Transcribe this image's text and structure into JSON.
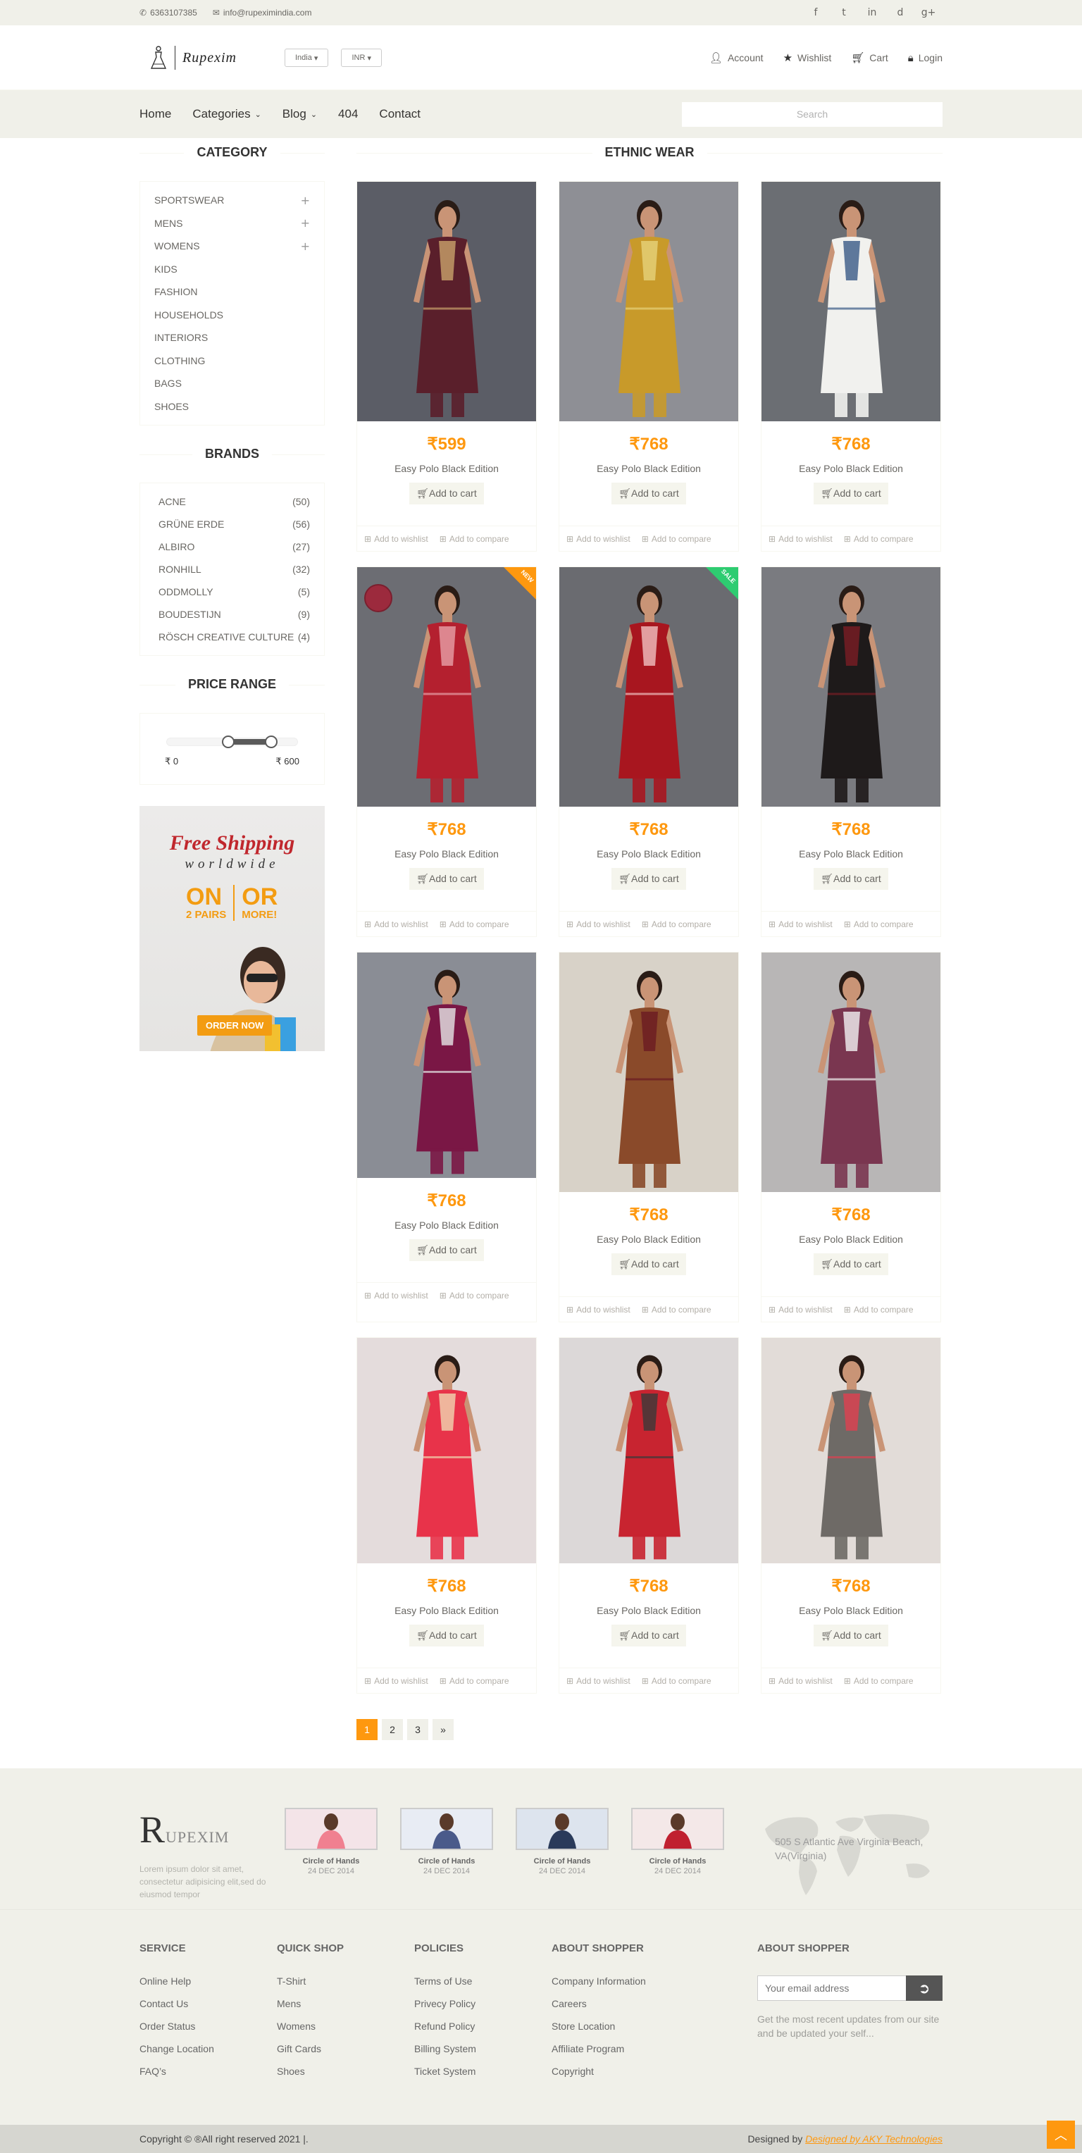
{
  "topbar": {
    "phone": "6363107385",
    "email": "info@rupeximindia.com",
    "social": [
      "f",
      "t",
      "in",
      "d",
      "g+"
    ]
  },
  "header": {
    "logo_text": "Rupexim",
    "country": "India",
    "currency": "INR",
    "nav": {
      "account": "Account",
      "wishlist": "Wishlist",
      "cart": "Cart",
      "login": "Login"
    }
  },
  "menu": {
    "items": [
      "Home",
      "Categories",
      "Blog",
      "404",
      "Contact"
    ],
    "search_placeholder": "Search"
  },
  "sidebar": {
    "category_title": "Category",
    "categories": [
      {
        "label": "SPORTSWEAR",
        "expand": "+"
      },
      {
        "label": "MENS",
        "expand": "+"
      },
      {
        "label": "WOMENS",
        "expand": "+"
      },
      {
        "label": "KIDS",
        "expand": ""
      },
      {
        "label": "FASHION",
        "expand": ""
      },
      {
        "label": "HOUSEHOLDS",
        "expand": ""
      },
      {
        "label": "INTERIORS",
        "expand": ""
      },
      {
        "label": "CLOTHING",
        "expand": ""
      },
      {
        "label": "BAGS",
        "expand": ""
      },
      {
        "label": "SHOES",
        "expand": ""
      }
    ],
    "brands_title": "Brands",
    "brands": [
      {
        "name": "ACNE",
        "count": "(50)"
      },
      {
        "name": "GRÜNE ERDE",
        "count": "(56)"
      },
      {
        "name": "ALBIRO",
        "count": "(27)"
      },
      {
        "name": "RONHILL",
        "count": "(32)"
      },
      {
        "name": "ODDMOLLY",
        "count": "(5)"
      },
      {
        "name": "BOUDESTIJN",
        "count": "(9)"
      },
      {
        "name": "RÖSCH CREATIVE CULTURE",
        "count": "(4)"
      }
    ],
    "price_title": "Price Range",
    "price_min": "₹ 0",
    "price_max": "₹ 600",
    "ad": {
      "line1": "Free Shipping",
      "line2": "worldwide",
      "on": "ON",
      "pairs": "2 PAIRS",
      "or": "OR",
      "more": "MORE!",
      "button": "ORDER NOW"
    }
  },
  "products": {
    "title": "Ethnic Wear",
    "wishlist_label": "Add to wishlist",
    "compare_label": "Add to compare",
    "cart_label": "Add to cart",
    "items": [
      {
        "price": "₹599",
        "name": "Easy Polo Black Edition",
        "color": "#5a1f2b",
        "bg": "#5b5d66",
        "trim": "#c9a26b"
      },
      {
        "price": "₹768",
        "name": "Easy Polo Black Edition",
        "color": "#c89a2a",
        "bg": "#8e8f95",
        "trim": "#e6d27a"
      },
      {
        "price": "₹768",
        "name": "Easy Polo Black Edition",
        "color": "#f1f1ee",
        "bg": "#6b6e73",
        "trim": "#3a5a86"
      },
      {
        "price": "₹768",
        "name": "Easy Polo Black Edition",
        "color": "#b4202f",
        "bg": "#6c6d73",
        "trim": "#e7a0a8",
        "badge": "NEW"
      },
      {
        "price": "₹768",
        "name": "Easy Polo Black Edition",
        "color": "#a8161f",
        "bg": "#6a6b70",
        "trim": "#f0c0c0",
        "badge": "SALE"
      },
      {
        "price": "₹768",
        "name": "Easy Polo Black Edition",
        "color": "#1e1a1a",
        "bg": "#7a7b80",
        "trim": "#7a1d24"
      },
      {
        "price": "₹768",
        "name": "Easy Polo Black Edition",
        "color": "#7a1745",
        "bg": "#8a8d95",
        "trim": "#e6e6e6"
      },
      {
        "price": "₹768",
        "name": "Easy Polo Black Edition",
        "color": "#8a4a2a",
        "bg": "#d8d2c8",
        "trim": "#6a1a22"
      },
      {
        "price": "₹768",
        "name": "Easy Polo Black Edition",
        "color": "#7a3650",
        "bg": "#b8b6b6",
        "trim": "#f2f2f2"
      },
      {
        "price": "₹768",
        "name": "Easy Polo Black Edition",
        "color": "#e8334a",
        "bg": "#e4dcdc",
        "trim": "#f0d6b0"
      },
      {
        "price": "₹768",
        "name": "Easy Polo Black Edition",
        "color": "#c82430",
        "bg": "#dcd8d8",
        "trim": "#3a3a3a"
      },
      {
        "price": "₹768",
        "name": "Easy Polo Black Edition",
        "color": "#6e6a66",
        "bg": "#e2dcd8",
        "trim": "#e04050"
      }
    ]
  },
  "pagination": [
    "1",
    "2",
    "3",
    "»"
  ],
  "footer": {
    "company_initial": "R",
    "company_rest": "UPEXIM",
    "company_text": "Lorem ipsum dolor sit amet, consectetur adipisicing elit,sed do eiusmod tempor",
    "videos": [
      {
        "title": "Circle of Hands",
        "date": "24 DEC 2014"
      },
      {
        "title": "Circle of Hands",
        "date": "24 DEC 2014"
      },
      {
        "title": "Circle of Hands",
        "date": "24 DEC 2014"
      },
      {
        "title": "Circle of Hands",
        "date": "24 DEC 2014"
      }
    ],
    "address": "505 S Atlantic Ave Virginia Beach, VA(Virginia)",
    "columns": [
      {
        "title": "SERVICE",
        "links": [
          "Online Help",
          "Contact Us",
          "Order Status",
          "Change Location",
          "FAQ’s"
        ]
      },
      {
        "title": "QUICK SHOP",
        "links": [
          "T-Shirt",
          "Mens",
          "Womens",
          "Gift Cards",
          "Shoes"
        ]
      },
      {
        "title": "POLICIES",
        "links": [
          "Terms of Use",
          "Privecy Policy",
          "Refund Policy",
          "Billing System",
          "Ticket System"
        ]
      },
      {
        "title": "ABOUT SHOPPER",
        "links": [
          "Company Information",
          "Careers",
          "Store Location",
          "Affiliate Program",
          "Copyright"
        ]
      }
    ],
    "newsletter_title": "ABOUT SHOPPER",
    "newsletter_placeholder": "Your email address",
    "newsletter_text": "Get the most recent updates from our site and be updated your self...",
    "copyright": "Copyright © ®All right reserved 2021 |.",
    "designed_by": "Designed by",
    "designer": "Designed by AKY Technologies"
  }
}
